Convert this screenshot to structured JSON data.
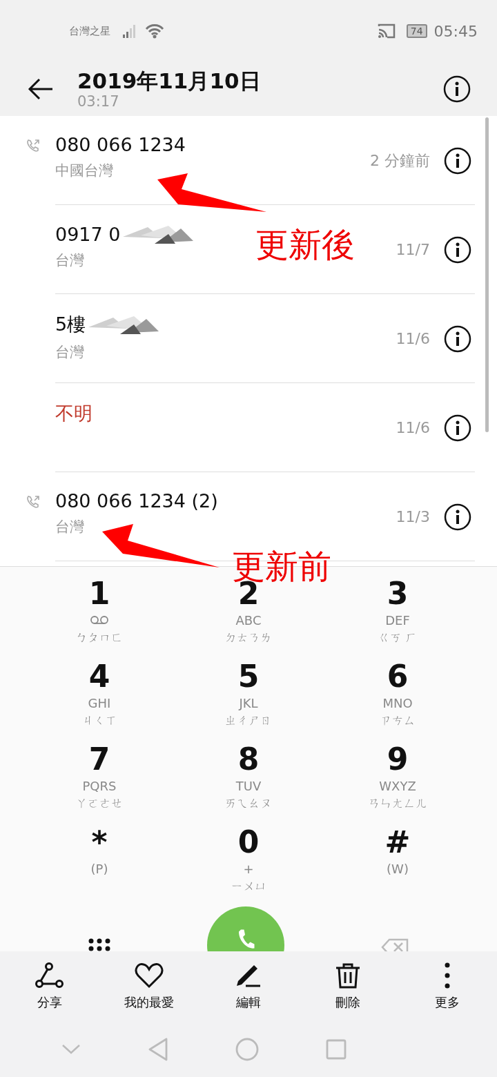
{
  "status_bar": {
    "carrier": "台灣之星",
    "battery": "74",
    "time": "05:45"
  },
  "header": {
    "title": "2019年11月10日",
    "subtitle": "03:17"
  },
  "calls": [
    {
      "number": "080 066 1234",
      "location": "中國台灣",
      "time": "2 分鐘前",
      "kind": "normal",
      "call_icon": true,
      "redacted": false
    },
    {
      "number": "0917 0",
      "location": "台灣",
      "time": "11/7",
      "kind": "normal",
      "call_icon": false,
      "redacted": true
    },
    {
      "number": "5樓",
      "location": "台灣",
      "time": "11/6",
      "kind": "normal",
      "call_icon": false,
      "redacted": true
    },
    {
      "number": "不明",
      "time": "11/6",
      "kind": "unknown",
      "call_icon": false,
      "redacted": false
    },
    {
      "number": "080 066 1234  (2)",
      "location": "台灣",
      "time": "11/3",
      "kind": "normal",
      "call_icon": true,
      "redacted": false
    }
  ],
  "dialpad": [
    {
      "digit": "1",
      "kind": "voicemail",
      "phonetic": "ㄅㄆㄇㄈ"
    },
    {
      "digit": "2",
      "kind": "letters",
      "letters": "ABC",
      "phonetic": "ㄉㄊㄋㄌ"
    },
    {
      "digit": "3",
      "kind": "letters",
      "letters": "DEF",
      "phonetic": "ㄍㄎ ㄏ"
    },
    {
      "digit": "4",
      "kind": "letters",
      "letters": "GHI",
      "phonetic": "ㄐㄑㄒ"
    },
    {
      "digit": "5",
      "kind": "letters",
      "letters": "JKL",
      "phonetic": "ㄓㄔㄕㄖ"
    },
    {
      "digit": "6",
      "kind": "letters",
      "letters": "MNO",
      "phonetic": "ㄗㄘㄙ"
    },
    {
      "digit": "7",
      "kind": "letters",
      "letters": "PQRS",
      "phonetic": "ㄚㄛㄜㄝ"
    },
    {
      "digit": "8",
      "kind": "letters",
      "letters": "TUV",
      "phonetic": "ㄞㄟㄠㄡ"
    },
    {
      "digit": "9",
      "kind": "letters",
      "letters": "WXYZ",
      "phonetic": "ㄢㄣㄤㄥㄦ"
    },
    {
      "digit": "*",
      "kind": "letters",
      "letters": "(P)"
    },
    {
      "digit": "0",
      "kind": "letters",
      "letters": "+",
      "phonetic": "ㄧㄨㄩ"
    },
    {
      "digit": "#",
      "kind": "letters",
      "letters": "(W)"
    }
  ],
  "actions": [
    {
      "label": "分享"
    },
    {
      "label": "我的最愛"
    },
    {
      "label": "編輯"
    },
    {
      "label": "刪除"
    },
    {
      "label": "更多"
    }
  ],
  "annotations": [
    {
      "text": "更新後"
    },
    {
      "text": "更新前"
    }
  ]
}
